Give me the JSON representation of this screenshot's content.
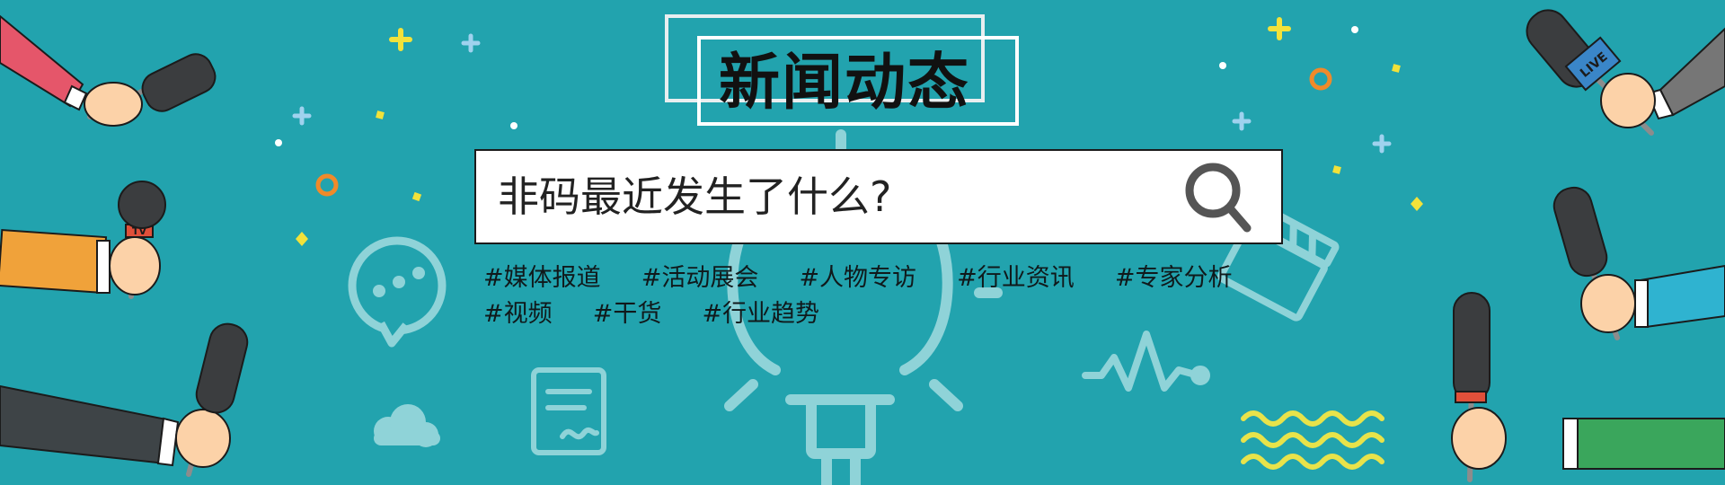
{
  "banner": {
    "title": "新闻动态",
    "search_text": "非码最近发生了什么?",
    "tags": [
      "#媒体报道",
      "#活动展会",
      "#人物专访",
      "#行业资讯",
      "#专家分析",
      "#视频",
      "#干货",
      "#行业趋势"
    ],
    "mic_label_live": "LIVE",
    "mic_label_tv": "TV"
  },
  "colors": {
    "background": "#22a3ae",
    "decor_light": "#8fd3d8",
    "yellow": "#f2e23a",
    "orange": "#f08a2a",
    "mic_dark": "#3b3d3f",
    "skin": "#fcd2a8"
  },
  "icons": [
    "search-icon",
    "lightbulb-icon",
    "chat-bubble-icon",
    "cloud-icon",
    "document-icon",
    "clapperboard-icon",
    "pulse-line-icon",
    "microphone-icon"
  ]
}
